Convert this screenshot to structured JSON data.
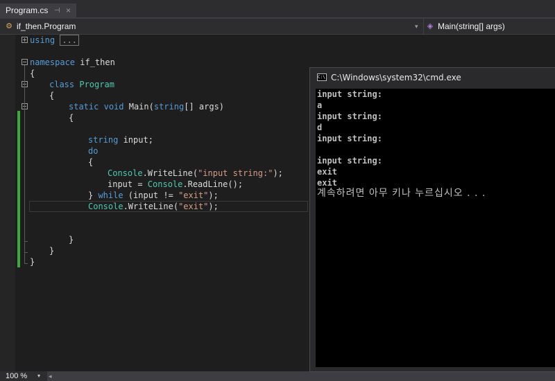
{
  "tab": {
    "title": "Program.cs",
    "pin": "⊣",
    "close": "×"
  },
  "navbar": {
    "class_selector": "if_then.Program",
    "member_selector": "Main(string[] args)",
    "dropdown_glyph": "▾"
  },
  "code": {
    "using_kw": "using",
    "using_collapsed": "...",
    "namespace_kw": "namespace",
    "namespace_name": " if_then",
    "open_brace": "{",
    "close_brace": "}",
    "class_kw": "class",
    "class_name": "Program",
    "static_kw": "static",
    "void_kw": "void",
    "main_name": " Main(",
    "string_kw": "string",
    "args": "[] args)",
    "input_decl": " input;",
    "do_kw": "do",
    "console_type": "Console",
    "writeline_call": ".WriteLine(",
    "input_str": "\"input string:\"",
    "call_end": ");",
    "input_assign": "input = ",
    "readline_call": ".ReadLine();",
    "close_while_start": "} ",
    "while_kw": "while",
    "while_cond": " (input != ",
    "exit_str": "\"exit\"",
    "close_paren_semi": ");"
  },
  "statusbar": {
    "zoom": "100 %",
    "dropdown_glyph": "▾",
    "scroll_left": "◂"
  },
  "console": {
    "title": "C:\\Windows\\system32\\cmd.exe",
    "icon_text": "C:\\",
    "lines": [
      "input string:",
      "a",
      "input string:",
      "d",
      "input string:",
      "",
      "input string:",
      "exit",
      "exit",
      "계속하려면 아무 키나 누르십시오 . . ."
    ]
  }
}
